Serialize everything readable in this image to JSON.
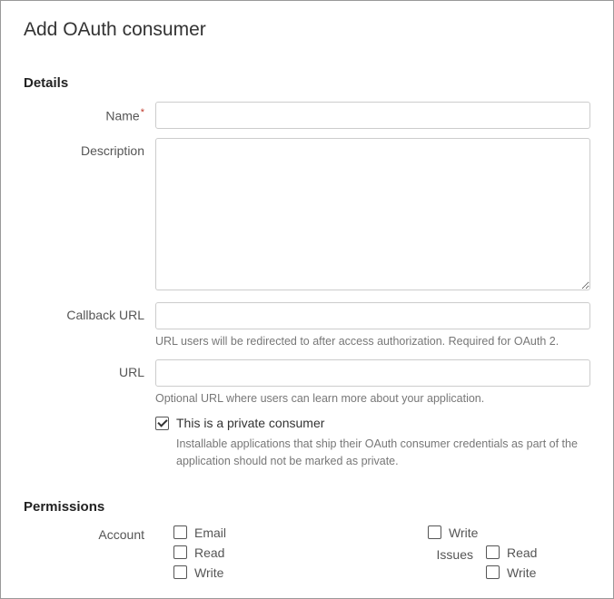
{
  "pageTitle": "Add OAuth consumer",
  "details": {
    "heading": "Details",
    "name": {
      "label": "Name",
      "required": true,
      "value": ""
    },
    "description": {
      "label": "Description",
      "value": ""
    },
    "callbackUrl": {
      "label": "Callback URL",
      "value": "",
      "help": "URL users will be redirected to after access authorization. Required for OAuth 2."
    },
    "url": {
      "label": "URL",
      "value": "",
      "help": "Optional URL where users can learn more about your application."
    },
    "privateConsumer": {
      "label": "This is a private consumer",
      "checked": true,
      "help": "Installable applications that ship their OAuth consumer credentials as part of the application should not be marked as private."
    }
  },
  "permissions": {
    "heading": "Permissions",
    "account": {
      "label": "Account",
      "items": [
        {
          "label": "Email",
          "checked": false
        },
        {
          "label": "Read",
          "checked": false
        },
        {
          "label": "Write",
          "checked": false
        }
      ]
    },
    "colB": {
      "items": [
        {
          "label": "Write",
          "checked": false
        }
      ]
    },
    "issues": {
      "label": "Issues",
      "items": [
        {
          "label": "Read",
          "checked": false
        },
        {
          "label": "Write",
          "checked": false
        }
      ]
    }
  }
}
